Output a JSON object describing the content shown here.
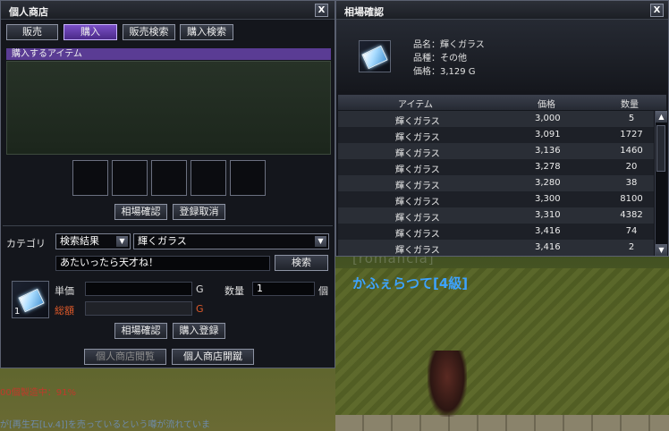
{
  "shop": {
    "title": "個人商店",
    "close": "X",
    "tabs": [
      "販売",
      "購入",
      "販売検索",
      "購入検索"
    ],
    "section_bar": "購入するアイテム",
    "buttons_top": [
      "相場確認",
      "登録取消"
    ],
    "category_label": "カテゴリ",
    "category_select": "検索結果",
    "item_select": "輝くガラス",
    "search_text": "あたいったら天才ね！",
    "search_button": "検索",
    "unit_price_label": "単価",
    "unit_price_suffix": "G",
    "quantity_label": "数量",
    "quantity_value": "1",
    "quantity_suffix": "個",
    "total_label": "総額",
    "total_suffix": "G",
    "stack_count": "1",
    "buttons_mid": [
      "相場確認",
      "購入登録"
    ],
    "buttons_bottom": [
      "個人商店閲覧",
      "個人商店開蹴"
    ]
  },
  "market": {
    "title": "相場確認",
    "close": "X",
    "name_line": "品名：輝くガラス",
    "kind_line": "品種：その他",
    "price_line": "価格：3,129 G",
    "columns": [
      "アイテム",
      "価格",
      "数量"
    ],
    "rows": [
      {
        "item": "輝くガラス",
        "price": "3,000",
        "qty": "5"
      },
      {
        "item": "輝くガラス",
        "price": "3,091",
        "qty": "1727"
      },
      {
        "item": "輝くガラス",
        "price": "3,136",
        "qty": "1460"
      },
      {
        "item": "輝くガラス",
        "price": "3,278",
        "qty": "20"
      },
      {
        "item": "輝くガラス",
        "price": "3,280",
        "qty": "38"
      },
      {
        "item": "輝くガラス",
        "price": "3,300",
        "qty": "8100"
      },
      {
        "item": "輝くガラス",
        "price": "3,310",
        "qty": "4382"
      },
      {
        "item": "輝くガラス",
        "price": "3,416",
        "qty": "74"
      },
      {
        "item": "輝くガラス",
        "price": "3,416",
        "qty": "2"
      }
    ],
    "scroll_up": "▲",
    "scroll_down": "▼"
  },
  "scene": {
    "guild_tag": "[romancia]",
    "player_name": "かふぇらつて[4級]"
  },
  "chat": [
    {
      "text": "00個製造中：91%",
      "color": "#c0392b"
    },
    {
      "text": "が[再生石[Lv.4]]を売っているという噂が流れていま",
      "color": "#6e8aa8"
    }
  ],
  "colors": {
    "accent": "#5a3c94",
    "total": "#e05a2a",
    "player_name": "#3da3ff"
  }
}
